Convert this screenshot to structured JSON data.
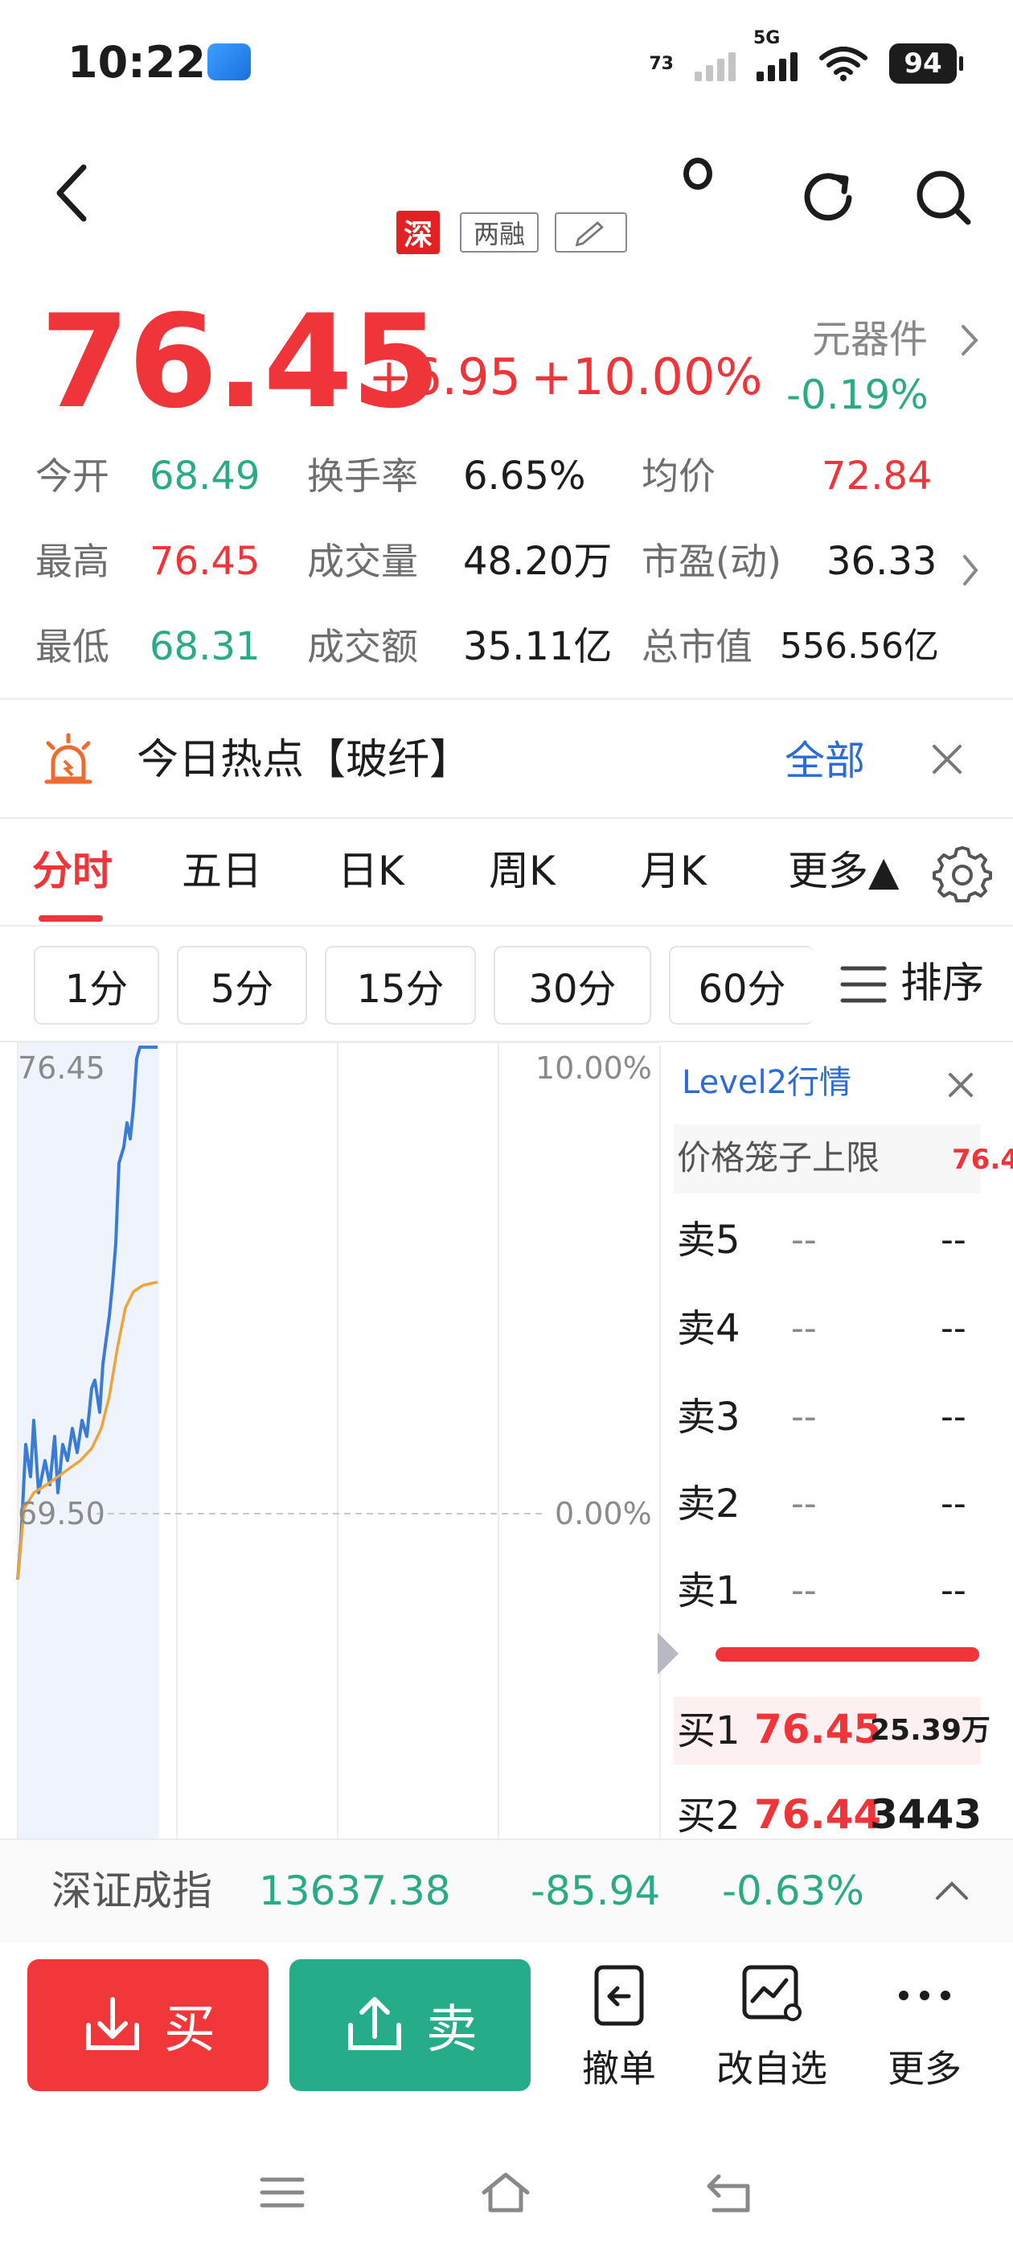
{
  "status_bar": {
    "time": "10:22",
    "battery": "94",
    "network": "5G",
    "speed": "73"
  },
  "header": {
    "badge_market": "深",
    "badge_margin": "两融"
  },
  "quote": {
    "price": "76.45",
    "change": "+6.95",
    "change_pct": "+10.00%",
    "sector_name": "元器件",
    "sector_change": "-0.19%"
  },
  "stats": {
    "open_label": "今开",
    "open_value": "68.49",
    "turnover_label": "换手率",
    "turnover_value": "6.65%",
    "avg_label": "均价",
    "avg_value": "72.84",
    "high_label": "最高",
    "high_value": "76.45",
    "volume_label": "成交量",
    "volume_value": "48.20万",
    "pe_label": "市盈(动)",
    "pe_value": "36.33",
    "low_label": "最低",
    "low_value": "68.31",
    "amount_label": "成交额",
    "amount_value": "35.11亿",
    "mktcap_label": "总市值",
    "mktcap_value": "556.56亿"
  },
  "hot_topic": {
    "title": "今日热点【玻纤】",
    "all_label": "全部"
  },
  "chart_tabs": [
    "分时",
    "五日",
    "日K",
    "周K",
    "月K",
    "更多▲"
  ],
  "intervals": [
    "1分",
    "5分",
    "15分",
    "30分",
    "60分"
  ],
  "sort_label": "排序",
  "chart": {
    "y_top_price": "76.45",
    "y_top_pct": "10.00%",
    "y_mid_price": "69.50",
    "y_mid_pct": "0.00%"
  },
  "order_book": {
    "title": "Level2行情",
    "cage_label": "价格笼子上限",
    "cage_value": "76.4",
    "asks": [
      {
        "label": "卖5",
        "price": "--",
        "volume": "--"
      },
      {
        "label": "卖4",
        "price": "--",
        "volume": "--"
      },
      {
        "label": "卖3",
        "price": "--",
        "volume": "--"
      },
      {
        "label": "卖2",
        "price": "--",
        "volume": "--"
      },
      {
        "label": "卖1",
        "price": "--",
        "volume": "--"
      }
    ],
    "bids": [
      {
        "label": "买1",
        "price": "76.45",
        "volume": "25.39万"
      },
      {
        "label": "买2",
        "price": "76.44",
        "volume": "3443"
      }
    ]
  },
  "index_bar": {
    "name": "深证成指",
    "value": "13637.38",
    "change": "-85.94",
    "change_pct": "-0.63%"
  },
  "actions": {
    "buy": "买",
    "sell": "卖",
    "cancel": "撤单",
    "watchlist": "改自选",
    "more": "更多"
  },
  "colors": {
    "up": "#f0353a",
    "down": "#2aaa86",
    "accent": "#2b6bd6"
  }
}
